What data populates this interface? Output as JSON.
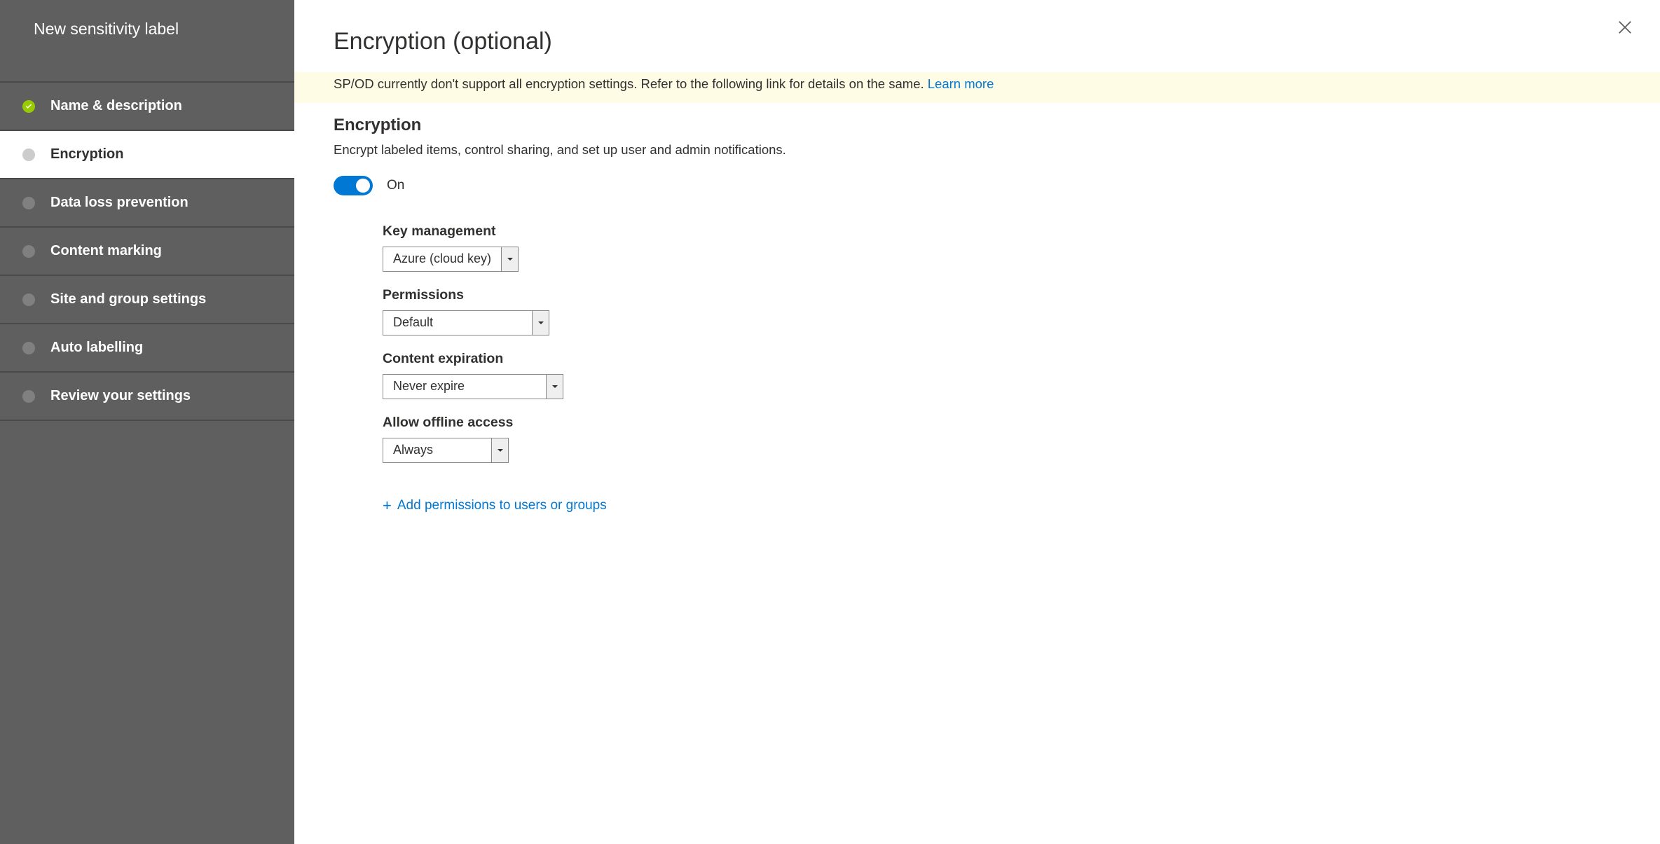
{
  "sidebar": {
    "title": "New sensitivity label",
    "items": [
      {
        "label": "Name & description",
        "state": "completed"
      },
      {
        "label": "Encryption",
        "state": "active"
      },
      {
        "label": "Data loss prevention",
        "state": "default"
      },
      {
        "label": "Content marking",
        "state": "default"
      },
      {
        "label": "Site and group settings",
        "state": "default"
      },
      {
        "label": "Auto labelling",
        "state": "default"
      },
      {
        "label": "Review your settings",
        "state": "default"
      }
    ]
  },
  "page": {
    "title": "Encryption (optional)",
    "banner_text": "SP/OD currently don't support all encryption settings. Refer to the following link for details on the same. ",
    "banner_link": "Learn more",
    "section_heading": "Encryption",
    "section_desc": "Encrypt labeled items, control sharing, and set up user and admin notifications.",
    "toggle_state": "On",
    "fields": {
      "key_management": {
        "label": "Key management",
        "value": "Azure (cloud key)"
      },
      "permissions": {
        "label": "Permissions",
        "value": "Default"
      },
      "content_expiration": {
        "label": "Content expiration",
        "value": "Never expire"
      },
      "offline_access": {
        "label": "Allow offline access",
        "value": "Always"
      }
    },
    "add_link": "Add permissions to users or groups"
  }
}
